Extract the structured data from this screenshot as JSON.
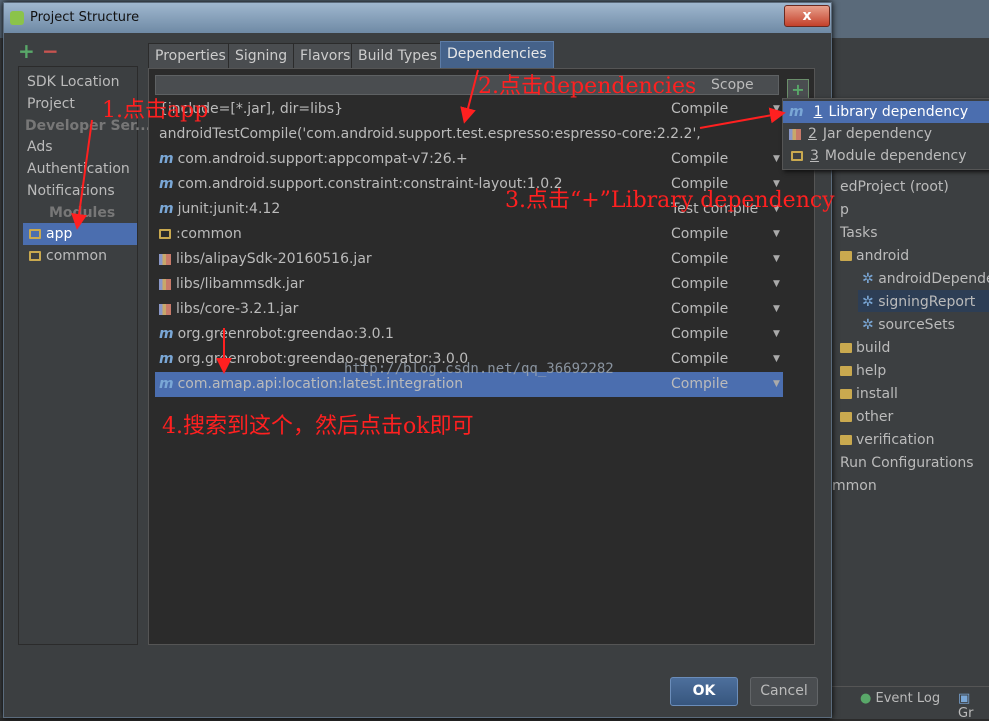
{
  "window": {
    "title": "Project Structure",
    "close_label": "x"
  },
  "left_nav": {
    "add_label": "+",
    "remove_label": "−",
    "sdk_location": "SDK Location",
    "project": "Project",
    "developer_services_header": "Developer Ser...",
    "ads": "Ads",
    "authentication": "Authentication",
    "notifications": "Notifications",
    "modules_header": "Modules",
    "modules": [
      {
        "label": "app",
        "selected": true
      },
      {
        "label": "common",
        "selected": false
      }
    ]
  },
  "tabs": [
    {
      "label": "Properties",
      "active": false
    },
    {
      "label": "Signing",
      "active": false
    },
    {
      "label": "Flavors",
      "active": false
    },
    {
      "label": "Build Types",
      "active": false
    },
    {
      "label": "Dependencies",
      "active": true
    }
  ],
  "table": {
    "scope_header": "Scope",
    "add_label": "+",
    "rows": [
      {
        "icon": "none",
        "name": "{include=[*.jar], dir=libs}",
        "scope": "Compile"
      },
      {
        "icon": "none",
        "name": "androidTestCompile('com.android.support.test.espresso:espresso-core:2.2.2',",
        "scope": ""
      },
      {
        "icon": "maven-library-icon",
        "name": "com.android.support:appcompat-v7:26.+",
        "scope": "Compile"
      },
      {
        "icon": "maven-library-icon",
        "name": "com.android.support.constraint:constraint-layout:1.0.2",
        "scope": "Compile"
      },
      {
        "icon": "maven-library-icon",
        "name": "junit:junit:4.12",
        "scope": "Test compile"
      },
      {
        "icon": "module-icon",
        "name": ":common",
        "scope": "Compile"
      },
      {
        "icon": "jar-icon",
        "name": "libs/alipaySdk-20160516.jar",
        "scope": "Compile"
      },
      {
        "icon": "jar-icon",
        "name": "libs/libammsdk.jar",
        "scope": "Compile"
      },
      {
        "icon": "jar-icon",
        "name": "libs/core-3.2.1.jar",
        "scope": "Compile"
      },
      {
        "icon": "maven-library-icon",
        "name": "org.greenrobot:greendao:3.0.1",
        "scope": "Compile"
      },
      {
        "icon": "maven-library-icon",
        "name": "org.greenrobot:greendao-generator:3.0.0",
        "scope": "Compile"
      },
      {
        "icon": "maven-library-icon",
        "name": "com.amap.api:location:latest.integration",
        "scope": "Compile",
        "selected": true
      }
    ]
  },
  "popup_menu": [
    {
      "num": "1",
      "label": "Library dependency",
      "icon": "maven-library-icon",
      "selected": true
    },
    {
      "num": "2",
      "label": "Jar dependency",
      "icon": "jar-icon",
      "selected": false
    },
    {
      "num": "3",
      "label": "Module dependency",
      "icon": "module-icon",
      "selected": false
    }
  ],
  "buttons": {
    "ok": "OK",
    "cancel": "Cancel"
  },
  "background_ide": {
    "tree": [
      "edProject (root)",
      "p",
      "Tasks",
      "android",
      "androidDepende",
      "signingReport",
      "sourceSets",
      "build",
      "help",
      "install",
      "other",
      "verification",
      "Run Configurations",
      "mmon"
    ],
    "bottom_tabs": [
      "Event Log",
      "Gr"
    ]
  },
  "annotations": {
    "step1": "1.点击app",
    "step2": "2.点击dependencies",
    "step3": "3.点击“+”Library dependency",
    "step4": "4.搜索到这个，然后点击ok即可",
    "watermark": "http://blog.csdn.net/qq_36692282"
  },
  "colors": {
    "selection": "#4b6eaf",
    "annotation": "#ff2020",
    "add_green": "#59a869",
    "remove_red": "#c75450"
  }
}
